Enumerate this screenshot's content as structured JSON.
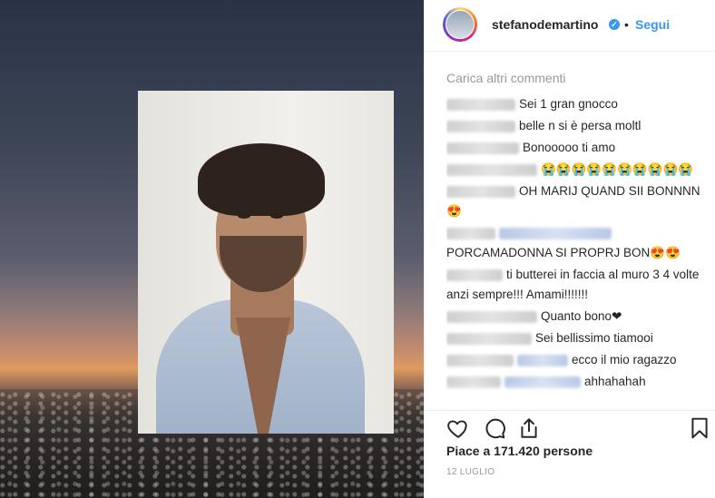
{
  "post": {
    "username": "stefanodemartino",
    "verified_mark": "✓",
    "separator": "•",
    "follow_label": "Segui"
  },
  "comments": {
    "load_more": "Carica altri commenti",
    "items": [
      {
        "text": "Sei 1 gran gnocco"
      },
      {
        "text": "belle n si è persa moltl"
      },
      {
        "text": "Bonooooo ti amo"
      },
      {
        "text": "😭😭😭😭😭😭😭😭😭😭"
      },
      {
        "text": "OH MARIJ QUAND SII BONNNN😍"
      },
      {
        "text": "PORCAMADONNA SI PROPRJ BON😍😍"
      },
      {
        "text": "ti butterei in faccia al muro 3 4 volte anzi sempre!!! Amami!!!!!!!"
      },
      {
        "text": "Quanto bono❤"
      },
      {
        "text": "Sei bellissimo tiamooi"
      },
      {
        "text": "ecco il mio ragazzo"
      },
      {
        "text": "ahhahahah"
      }
    ]
  },
  "actions": {
    "like_icon": "heart-icon",
    "comment_icon": "comment-icon",
    "share_icon": "share-icon",
    "save_icon": "bookmark-icon"
  },
  "likes_text": "Piace a 171.420 persone",
  "date_text": "12 LUGLIO",
  "colors": {
    "accent": "#3897f0",
    "text": "#262626",
    "muted": "#999999"
  }
}
